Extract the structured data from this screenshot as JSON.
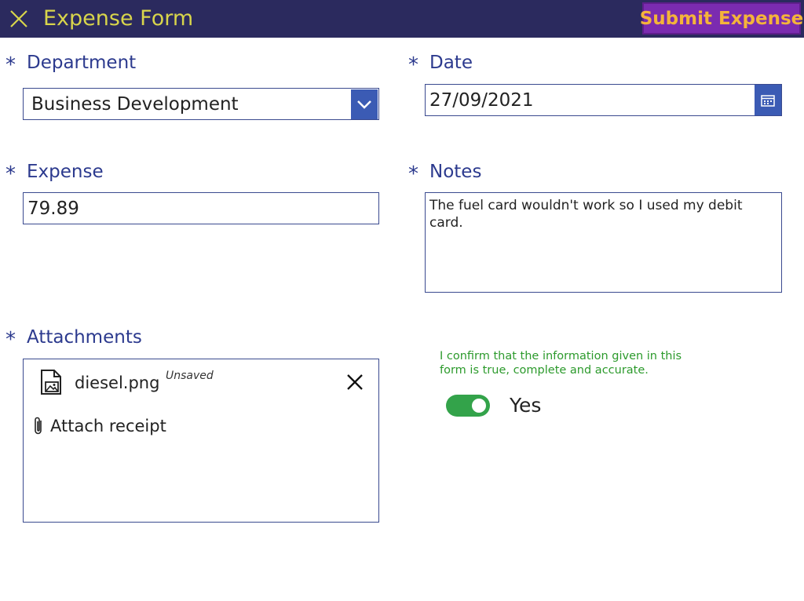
{
  "header": {
    "title": "Expense Form",
    "submit_label": "Submit Expense"
  },
  "fields": {
    "department": {
      "required_marker": "*",
      "label": "Department",
      "value": "Business Development"
    },
    "date": {
      "required_marker": "*",
      "label": "Date",
      "value": "27/09/2021"
    },
    "expense": {
      "required_marker": "*",
      "label": "Expense",
      "value": "79.89"
    },
    "notes": {
      "required_marker": "*",
      "label": "Notes",
      "value": "The fuel card wouldn't work so I used my debit card."
    },
    "attachments": {
      "required_marker": "*",
      "label": "Attachments",
      "files": [
        {
          "name": "diesel.png",
          "status": "Unsaved"
        }
      ],
      "attach_label": "Attach receipt"
    }
  },
  "confirmation": {
    "text": "I confirm that the information given in this form is true, complete and accurate.",
    "toggle_label": "Yes",
    "toggle_on": true
  },
  "colors": {
    "header_bg": "#2b2a5e",
    "title": "#d8d54b",
    "submit_bg": "#7b2bb0",
    "submit_text": "#f4b43a",
    "label": "#2c3a8e",
    "accent": "#3b5bb4",
    "confirm_text": "#2c9a2c",
    "toggle_on": "#33a34a"
  },
  "icons": {
    "close": "close-icon",
    "dropdown": "chevron-down-icon",
    "calendar": "calendar-icon",
    "image_file": "image-file-icon",
    "remove": "close-icon",
    "paperclip": "paperclip-icon"
  }
}
